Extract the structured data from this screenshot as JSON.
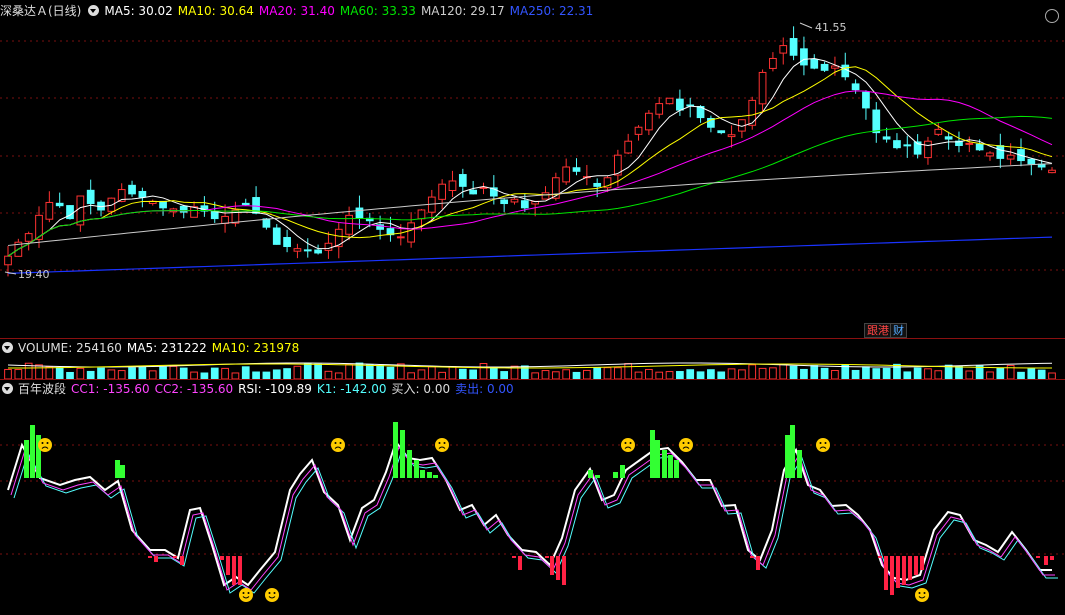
{
  "main_header": {
    "stock": "深桑达Ａ(日线)",
    "ma5": "MA5: 30.02",
    "ma10": "MA10: 30.64",
    "ma20": "MA20: 31.40",
    "ma60": "MA60: 33.33",
    "ma120": "MA120: 29.17",
    "ma250": "MA250: 22.31"
  },
  "price_labels": {
    "high": "41.55",
    "low": "19.40"
  },
  "tags": {
    "a": "跟港",
    "b": "财"
  },
  "volume_header": {
    "title": "VOLUME: 254160",
    "ma5": "MA5: 231222",
    "ma10": "MA10: 231978"
  },
  "ind_header": {
    "title": "百年波段",
    "cc1": "CC1: -135.60",
    "cc2": "CC2: -135.60",
    "rsi": "RSI: -109.89",
    "k1": "K1: -142.00",
    "buy": "买入: 0.00",
    "sell": "卖出: 0.00"
  },
  "colors": {
    "up": "#ff3232",
    "down": "#54ffff",
    "ma5": "#ffffff",
    "ma10": "#ffff00",
    "ma20": "#ff00ff",
    "ma60": "#00e600",
    "ma120": "#cccccc",
    "ma250": "#1a33ff"
  },
  "chart_data": {
    "type": "candlestick",
    "title": "深桑达Ａ(日线)",
    "price_range": [
      19.4,
      41.55
    ],
    "close": [
      20.5,
      21.8,
      22.6,
      24.3,
      25.5,
      25.2,
      24.0,
      26.1,
      25.4,
      24.8,
      25.9,
      26.7,
      26.3,
      26.0,
      25.6,
      25.0,
      24.9,
      24.6,
      25.1,
      24.7,
      24.0,
      24.2,
      24.8,
      25.3,
      24.5,
      23.2,
      21.6,
      21.4,
      21.2,
      21.0,
      20.8,
      21.7,
      23.0,
      24.3,
      24.1,
      23.8,
      23.0,
      22.5,
      22.3,
      23.6,
      24.8,
      26.0,
      27.2,
      27.5,
      27.0,
      26.3,
      26.9,
      26.1,
      25.4,
      25.8,
      25.0,
      25.6,
      26.4,
      27.8,
      28.8,
      28.4,
      27.9,
      27.0,
      27.8,
      29.9,
      31.2,
      32.5,
      33.8,
      34.7,
      35.2,
      34.1,
      34.5,
      33.4,
      32.5,
      32.0,
      31.8,
      33.2,
      35.0,
      37.6,
      38.9,
      40.1,
      39.2,
      38.3,
      38.0,
      37.8,
      38.2,
      37.2,
      36.0,
      34.3,
      32.0,
      31.4,
      30.6,
      30.8,
      30.0,
      31.2,
      32.3,
      31.4,
      30.8,
      31.0,
      30.4,
      30.1,
      29.6,
      29.9,
      29.4,
      29.1,
      28.8,
      28.5
    ],
    "volume_ma5": 231222,
    "volume_ma10": 231978
  }
}
